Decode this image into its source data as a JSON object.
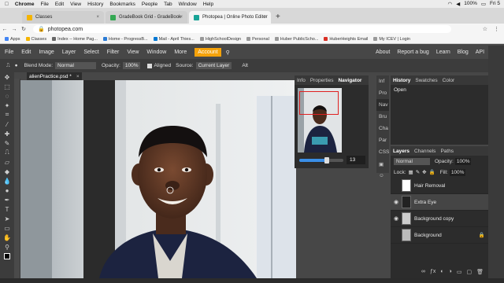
{
  "mac_menu": {
    "app": "Chrome",
    "items": [
      "File",
      "Edit",
      "View",
      "History",
      "Bookmarks",
      "People",
      "Tab",
      "Window",
      "Help"
    ],
    "battery": "100%",
    "clock": "Fri 5"
  },
  "browser": {
    "tabs": [
      {
        "label": "Classes",
        "color": "#f4b400",
        "active": false
      },
      {
        "label": "GradeBook Grid - GradeBook",
        "color": "#34a853",
        "active": false
      },
      {
        "label": "Photopea | Online Photo Editor",
        "color": "#18a497",
        "active": true
      }
    ],
    "new_tab": "+",
    "url": "photopea.com",
    "bookmarks": [
      {
        "label": "Apps",
        "color": "#4285f4"
      },
      {
        "label": "Classes",
        "color": "#f4b400"
      },
      {
        "label": "Index -- Home Pag...",
        "color": "#666"
      },
      {
        "label": "Home - ProgressB...",
        "color": "#2a7bd5"
      },
      {
        "label": "Mail - April Thies...",
        "color": "#0078d4"
      },
      {
        "label": "HighSchoolDesign",
        "color": "#999"
      },
      {
        "label": "Personal",
        "color": "#999"
      },
      {
        "label": "Huber PublicScho...",
        "color": "#999"
      },
      {
        "label": "HuberHeights Email",
        "color": "#d93025"
      },
      {
        "label": "My ICEV | Login",
        "color": "#999"
      }
    ]
  },
  "photopea": {
    "menu": [
      "File",
      "Edit",
      "Image",
      "Layer",
      "Select",
      "Filter",
      "View",
      "Window",
      "More"
    ],
    "account": "Account",
    "menu_right": [
      "About",
      "Report a bug",
      "Learn",
      "Blog",
      "API"
    ],
    "options": {
      "blend_label": "Blend Mode:",
      "blend_value": "Normal",
      "opacity_label": "Opacity:",
      "opacity_value": "100%",
      "aligned": "Aligned",
      "source_label": "Source:",
      "source_value": "Current Layer",
      "alt": "Alt"
    },
    "doc_tab": "alienPractice.psd *",
    "navigator": {
      "tabs": [
        "Info",
        "Properties",
        "Navigator"
      ],
      "zoom_value": "13"
    },
    "mini_panels": [
      "Inf",
      "Pro",
      "Nav",
      "Bru",
      "Cha",
      "Par",
      "CSS"
    ],
    "history": {
      "tabs": [
        "History",
        "Swatches",
        "Color"
      ],
      "items": [
        "Open"
      ]
    },
    "layers": {
      "tabs": [
        "Layers",
        "Channels",
        "Paths"
      ],
      "blend": "Normal",
      "opacity_label": "Opacity:",
      "opacity_value": "100%",
      "lock_label": "Lock:",
      "fill_label": "Fill:",
      "fill_value": "100%",
      "items": [
        {
          "name": "Hair Removal",
          "visible": false
        },
        {
          "name": "Extra Eye",
          "visible": true
        },
        {
          "name": "Background copy",
          "visible": true
        },
        {
          "name": "Background",
          "visible": false
        }
      ]
    }
  }
}
